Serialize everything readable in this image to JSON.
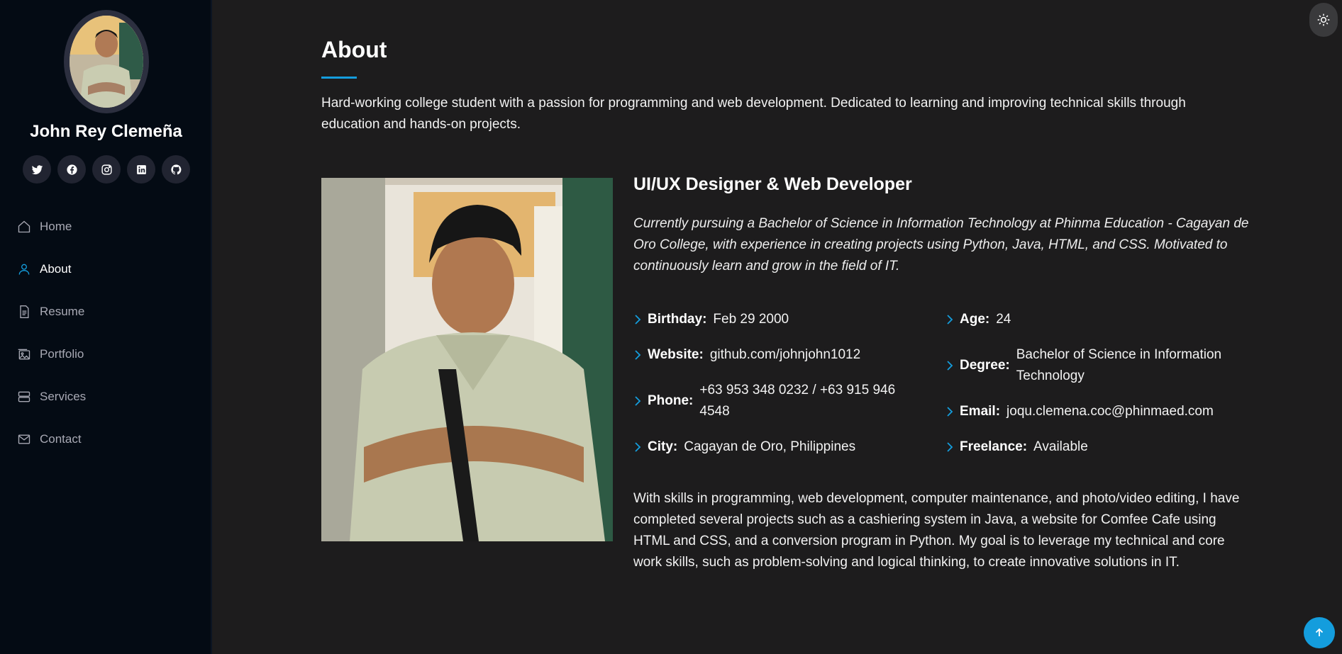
{
  "profile": {
    "name": "John Rey Clemeña"
  },
  "social": [
    {
      "icon": "twitter-icon"
    },
    {
      "icon": "facebook-icon"
    },
    {
      "icon": "instagram-icon"
    },
    {
      "icon": "linkedin-icon"
    },
    {
      "icon": "github-icon"
    }
  ],
  "nav": [
    {
      "label": "Home",
      "icon": "home-icon",
      "active": false
    },
    {
      "label": "About",
      "icon": "person-icon",
      "active": true
    },
    {
      "label": "Resume",
      "icon": "file-icon",
      "active": false
    },
    {
      "label": "Portfolio",
      "icon": "images-icon",
      "active": false
    },
    {
      "label": "Services",
      "icon": "server-icon",
      "active": false
    },
    {
      "label": "Contact",
      "icon": "envelope-icon",
      "active": false
    }
  ],
  "about": {
    "title": "About",
    "intro": "Hard-working college student with a passion for programming and web development. Dedicated to learning and improving technical skills through education and hands-on projects.",
    "role": "UI/UX Designer & Web Developer",
    "lead": "Currently pursuing a Bachelor of Science in Information Technology at Phinma Education - Cagayan de Oro College, with experience in creating projects using Python, Java, HTML, and CSS. Motivated to continuously learn and grow in the field of IT.",
    "facts": {
      "birthday": {
        "label": "Birthday:",
        "value": "Feb 29 2000"
      },
      "website": {
        "label": "Website:",
        "value": "github.com/johnjohn1012"
      },
      "phone": {
        "label": "Phone:",
        "value": "+63 953 348 0232 / +63 915 946 4548"
      },
      "city": {
        "label": "City:",
        "value": "Cagayan de Oro, Philippines"
      },
      "age": {
        "label": "Age:",
        "value": "24"
      },
      "degree": {
        "label": "Degree:",
        "value": "Bachelor of Science in Information Technology"
      },
      "email": {
        "label": "Email:",
        "value": "joqu.clemena.coc@phinmaed.com"
      },
      "freelance": {
        "label": "Freelance:",
        "value": "Available"
      }
    },
    "outro": "With skills in programming, web development, computer maintenance, and photo/video editing, I have completed several projects such as a cashiering system in Java, a website for Comfee Cafe using HTML and CSS, and a conversion program in Python. My goal is to leverage my technical and core work skills, such as problem-solving and logical thinking, to create innovative solutions in IT."
  },
  "colors": {
    "accent": "#149ddd",
    "sidebar": "#040b14",
    "background": "#1d1c1d"
  }
}
